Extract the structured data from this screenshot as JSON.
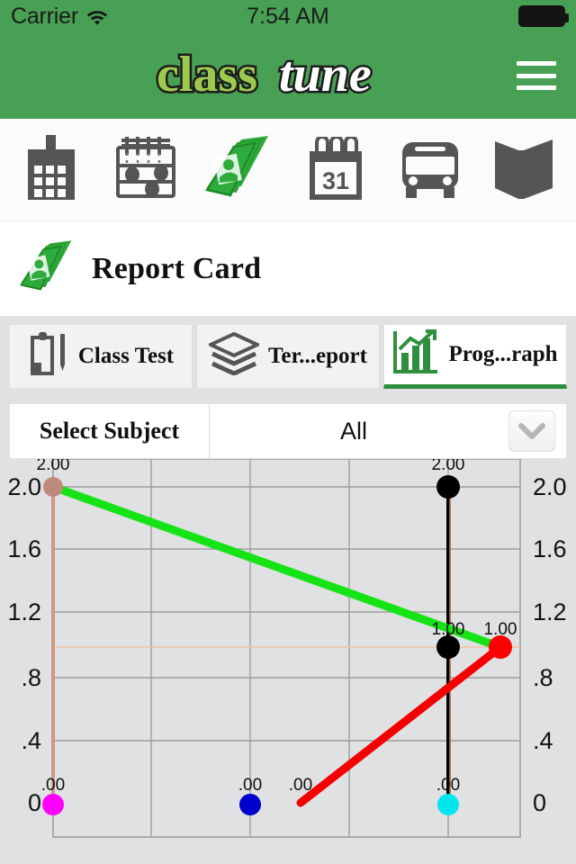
{
  "status_bar": {
    "carrier": "Carrier",
    "wifi_icon": "wifi-icon",
    "time": "7:54 AM",
    "battery_icon": "battery-full-icon"
  },
  "header": {
    "brand_part1": "class",
    "brand_part2": "tune",
    "menu_icon": "hamburger-menu-icon",
    "background_color": "#48a054"
  },
  "icon_toolbar": {
    "items": [
      {
        "name": "school-building-icon",
        "label": "School"
      },
      {
        "name": "abacus-icon",
        "label": "Gradebook"
      },
      {
        "name": "report-card-icon",
        "label": "Report Card",
        "active": true
      },
      {
        "name": "calendar-31-icon",
        "label": "Calendar"
      },
      {
        "name": "bus-icon",
        "label": "Transport"
      },
      {
        "name": "open-book-icon",
        "label": "Library"
      }
    ]
  },
  "page": {
    "title": "Report Card",
    "title_icon": "report-card-icon"
  },
  "tabs": [
    {
      "label": "Class Test",
      "icon": "clipboard-pencil-icon",
      "active": false
    },
    {
      "label": "Ter...eport",
      "icon": "layers-icon",
      "active": false
    },
    {
      "label": "Prog...raph",
      "icon": "bar-chart-growth-icon",
      "active": true
    }
  ],
  "subject_selector": {
    "label": "Select Subject",
    "value": "All",
    "caret_icon": "chevron-down-icon"
  },
  "chart_data": {
    "type": "line",
    "title": "",
    "xlabel": "",
    "ylabel": "",
    "xlim": [
      -5,
      110
    ],
    "ylim": [
      0,
      2.1
    ],
    "x_ticks": [
      0,
      20,
      40,
      60,
      80
    ],
    "y_ticks_left": [
      "2.0",
      "1.6",
      "1.2",
      ".8",
      ".4",
      "0"
    ],
    "y_ticks_right": [
      "2.0",
      "1.6",
      "1.2",
      ".8",
      ".4",
      "0"
    ],
    "grid": true,
    "legend": "none",
    "series": [
      {
        "name": "green-series",
        "color": "#16e316",
        "points": [
          {
            "x": 0,
            "y": 2.0,
            "label": "2.00",
            "marker_color": "#bf8a7c"
          },
          {
            "x": 90,
            "y": 1.0,
            "label": "1.00",
            "marker_color": "#ff0000"
          }
        ]
      },
      {
        "name": "red-series",
        "color": "#f40000",
        "points": [
          {
            "x": 53,
            "y": 0.0,
            "label": ".00",
            "marker_color": "#f40000"
          },
          {
            "x": 90,
            "y": 1.0,
            "label": "1.00",
            "marker_color": "#ff0000"
          }
        ]
      },
      {
        "name": "black-series",
        "color": "#000000",
        "points": [
          {
            "x": 80,
            "y": 2.0,
            "label": "2.00",
            "marker_color": "#000000"
          },
          {
            "x": 80,
            "y": 1.0,
            "label": "1.00",
            "marker_color": "#000000"
          },
          {
            "x": 80,
            "y": 0.0,
            "label": ".00",
            "marker_color": "#00e5ee"
          }
        ]
      },
      {
        "name": "tan-series",
        "color": "#d9a58c",
        "points": [
          {
            "x": 0,
            "y": 2.0,
            "label": "2.00",
            "marker_color": "#bf8a7c"
          },
          {
            "x": 0,
            "y": 0.0,
            "label": ".00",
            "marker_color": "#ff00ff"
          }
        ]
      },
      {
        "name": "blue-series",
        "color": "#0000cd",
        "points": [
          {
            "x": 41,
            "y": 0.0,
            "label": ".00",
            "marker_color": "#0000cd"
          }
        ]
      }
    ]
  }
}
